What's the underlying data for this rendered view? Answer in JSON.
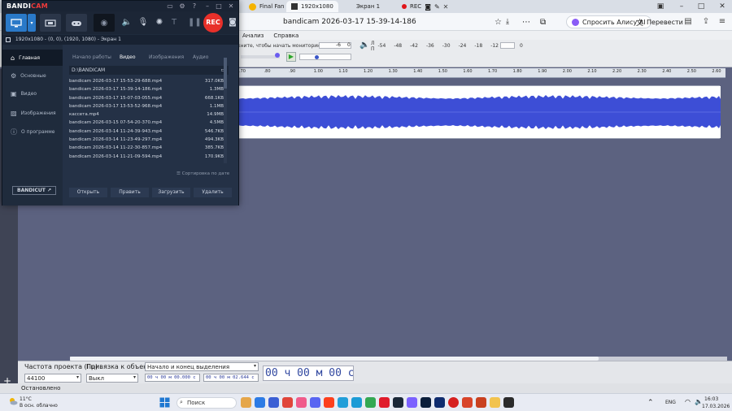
{
  "browser": {
    "tabs": [
      {
        "label": "Final Fan"
      },
      {
        "label": "1920x1080"
      },
      {
        "label": "Экран 1"
      },
      {
        "label": "REC"
      }
    ],
    "page_title": "bandicam 2026-03-17 15-39-14-186",
    "alice_label": "Спросить Алису AI",
    "translate_label": "Перевести"
  },
  "audacity": {
    "menu": [
      "Анализ",
      "Справка"
    ],
    "monitor_hint": "кните, чтобы начать мониторинг",
    "meter_scale": [
      "-54",
      "-48",
      "-42",
      "-36",
      "-30",
      "-24",
      "-18",
      "-12",
      "-6",
      "0"
    ],
    "meter_scale_short": [
      "-6",
      "0"
    ],
    "ruler": [
      ".70",
      ".80",
      ".90",
      "1.00",
      "1.10",
      "1.20",
      "1.30",
      "1.40",
      "1.50",
      "1.60",
      "1.70",
      "1.80",
      "1.90",
      "2.00",
      "2.10",
      "2.20",
      "2.30",
      "2.40",
      "2.50",
      "2.60"
    ],
    "selection_bar": {
      "rate_label": "Частота проекта (Гц)",
      "rate_value": "44100",
      "snap_label": "Привязка к объекту",
      "snap_value": "Выкл",
      "range_label": "Начало и конец выделения",
      "start_time": "00 ч 00 м 00.000 с",
      "end_time": "00 ч 00 м 02.644 с",
      "big_time": "00 ч 00 м 00 с"
    },
    "status": "Остановлено"
  },
  "bandicam": {
    "logo_main": "BANDI",
    "logo_accent": "CAM",
    "rec_label": "REC",
    "info_text": "1920x1080 - (0, 0), (1920, 1080) - Экран 1",
    "nav": [
      {
        "label": "Главная"
      },
      {
        "label": "Основные"
      },
      {
        "label": "Видео"
      },
      {
        "label": "Изображения"
      },
      {
        "label": "О программе"
      }
    ],
    "bandicut_label": "BANDICUT ↗",
    "tabs": [
      {
        "label": "Начало работы"
      },
      {
        "label": "Видео"
      },
      {
        "label": "Изображения"
      },
      {
        "label": "Аудио"
      }
    ],
    "path": "D:\\BANDICAM",
    "files": [
      {
        "name": "bandicam 2026-03-17 15-53-29-688.mp4",
        "size": "317.0KB"
      },
      {
        "name": "bandicam 2026-03-17 15-39-14-186.mp4",
        "size": "1.3MB"
      },
      {
        "name": "bandicam 2026-03-17 15-07-03-055.mp4",
        "size": "668.1KB"
      },
      {
        "name": "bandicam 2026-03-17 13-53-52-968.mp4",
        "size": "1.1MB"
      },
      {
        "name": "кассета.mp4",
        "size": "14.9MB"
      },
      {
        "name": "bandicam 2026-03-15 07-54-20-370.mp4",
        "size": "4.5MB"
      },
      {
        "name": "bandicam 2026-03-14 11-24-39-943.mp4",
        "size": "546.7KB"
      },
      {
        "name": "bandicam 2026-03-14 11-23-49-297.mp4",
        "size": "494.3KB"
      },
      {
        "name": "bandicam 2026-03-14 11-22-30-857.mp4",
        "size": "385.7KB"
      },
      {
        "name": "bandicam 2026-03-14 11-21-09-594.mp4",
        "size": "170.9KB"
      }
    ],
    "sort_label": "Сортировка по дате",
    "actions": [
      {
        "label": "Открыть"
      },
      {
        "label": "Править"
      },
      {
        "label": "Загрузить"
      },
      {
        "label": "Удалить"
      }
    ]
  },
  "taskbar": {
    "weather_temp": "11°C",
    "weather_desc": "В осн. облачно",
    "search_placeholder": "Поиск",
    "lang": "ENG",
    "time": "16:03",
    "date": "17.03.2026"
  },
  "colors": {
    "bandicam_accent": "#2a79c8",
    "rec_red": "#e8302a",
    "waveform": "#3d4ed6",
    "audacity_bg": "#5c6280"
  }
}
